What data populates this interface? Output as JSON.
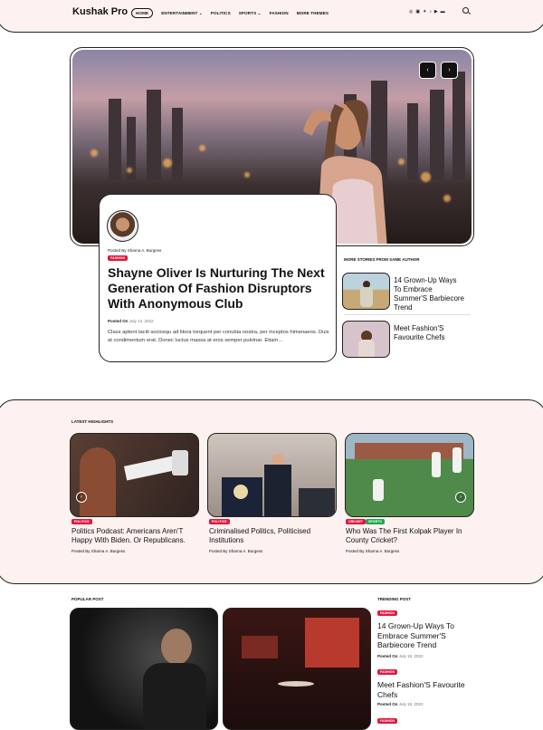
{
  "header": {
    "logo": "Kushak Pro",
    "nav": [
      {
        "label": "HOME"
      },
      {
        "label": "ENTERTAINMENT ⌄"
      },
      {
        "label": "POLITICS"
      },
      {
        "label": "SPORTS ⌄"
      },
      {
        "label": "FASHION"
      },
      {
        "label": "MORE THEMES"
      }
    ],
    "social_icons": [
      "instagram-icon",
      "facebook-icon",
      "twitter-icon",
      "tiktok-icon",
      "youtube-icon",
      "vk-icon"
    ]
  },
  "hero": {
    "prev_arrow": "‹",
    "next_arrow": "›",
    "posted_by": "Posted By Sharna A. Burgess",
    "category": "FASHION",
    "title": "Shayne Oliver Is Nurturing The Next Generation Of Fashion Disruptors With Anonymous Club",
    "posted_on_label": "Posted On",
    "posted_on_date": "July 13, 2022",
    "excerpt": "Class aptent taciti sociosqu ad litora torquent per conubia nostra, per inceptos himenaeos. Duis at condimentum erat. Donec luctus massa at eros semper pulvinar. Etiam…"
  },
  "more_stories": {
    "label": "MORE STORIES FROM SAME AUTHOR",
    "items": [
      {
        "title": "14 Grown-Up Ways To Embrace Summer'S Barbiecore Trend"
      },
      {
        "title": "Meet Fashion'S Favourite Chefs"
      }
    ]
  },
  "highlights": {
    "label": "LATEST HIGHLIGHTS",
    "items": [
      {
        "badges": [
          "POLITICS"
        ],
        "title": "Politics Podcast: Americans Aren'T Happy With Biden. Or Republicans.",
        "posted": "Posted By Sharna A. Burgess"
      },
      {
        "badges": [
          "POLITICS"
        ],
        "title": "Criminalised Politics, Politicised Institutions",
        "posted": "Posted By Sharna A. Burgess"
      },
      {
        "badges": [
          "CRICKET",
          "SPORTS"
        ],
        "title": "Who Was The First Kolpak Player In County Cricket?",
        "posted": "Posted By Sharna A. Burgess"
      }
    ]
  },
  "popular": {
    "label": "POPULAR POST"
  },
  "trending": {
    "label": "TRENDING POST",
    "items": [
      {
        "category": "FASHION",
        "title": "14 Grown-Up Ways To Embrace Summer'S Barbiecore Trend",
        "posted_on_label": "Posted On",
        "date": "July 18, 2022"
      },
      {
        "category": "FASHION",
        "title": "Meet Fashion'S Favourite Chefs",
        "posted_on_label": "Posted On",
        "date": "July 18, 2022"
      },
      {
        "category": "FASHION"
      }
    ]
  },
  "colors": {
    "accent": "#e4163a",
    "green_badge": "#1fa84f",
    "section_bg": "#fdf2ef"
  }
}
